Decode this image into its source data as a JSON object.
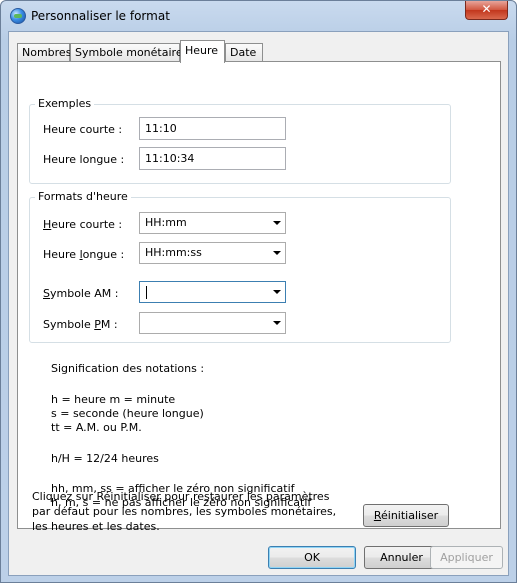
{
  "window": {
    "title": "Personnaliser le format",
    "close_label": "✕"
  },
  "tabs": [
    {
      "label": "Nombres"
    },
    {
      "label": "Symbole monétaire"
    },
    {
      "label": "Heure"
    },
    {
      "label": "Date"
    }
  ],
  "examples": {
    "group_title": "Exemples",
    "short_label": "Heure courte :",
    "short_value": "11:10",
    "long_label": "Heure longue :",
    "long_value": "11:10:34"
  },
  "formats": {
    "group_title": "Formats d'heure",
    "short_label": "Heure courte :",
    "short_value": "HH:mm",
    "long_label": "Heure longue :",
    "long_value": "HH:mm:ss",
    "am_label": "Symbole AM :",
    "am_value": "",
    "pm_label": "Symbole PM :",
    "pm_value": ""
  },
  "notation": {
    "heading": "Signification des notations :",
    "line1": "h = heure   m = minute",
    "line2": "s = seconde (heure longue)",
    "line3": "tt = A.M. ou P.M.",
    "line4": "h/H = 12/24 heures",
    "line5": "hh, mm, ss = afficher le zéro non significatif",
    "line6": "h, m, s = ne pas afficher le zéro non significatif"
  },
  "reset": {
    "text": "Cliquez sur Réinitialiser pour restaurer les paramètres par défaut pour les nombres, les symboles monétaires, les heures et les dates.",
    "button_label": "Réinitialiser"
  },
  "buttons": {
    "ok": "OK",
    "cancel": "Annuler",
    "apply": "Appliquer"
  }
}
